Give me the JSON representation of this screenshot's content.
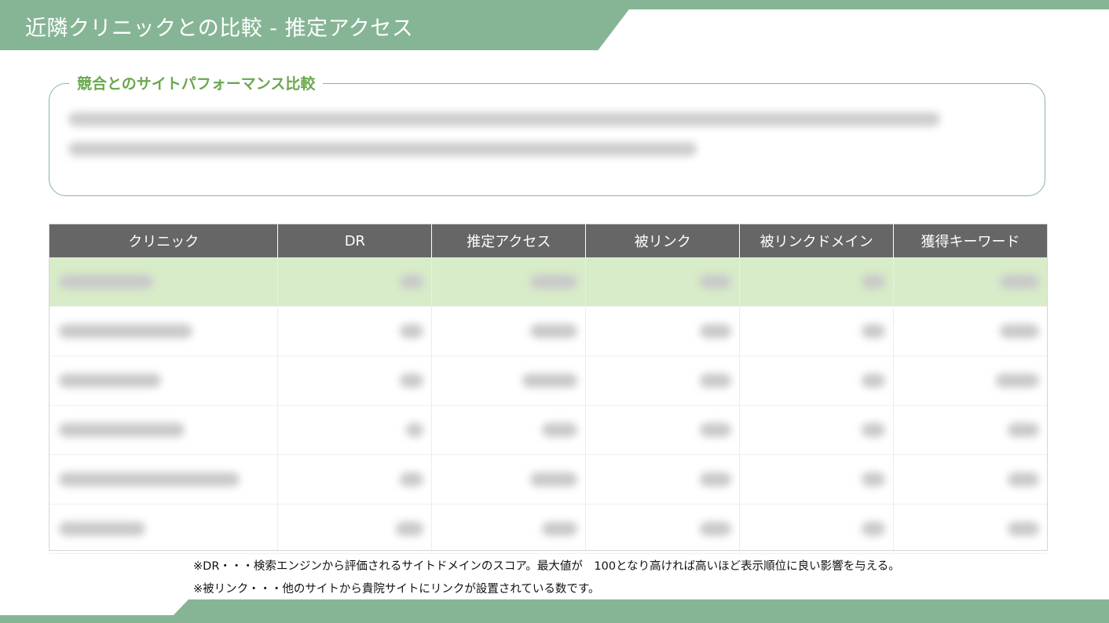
{
  "header": {
    "title": "近隣クリニックとの比較 - 推定アクセス",
    "accent_color": "#86b596"
  },
  "summary": {
    "heading": "競合とのサイトパフォーマンス比較",
    "heading_color": "#6aa850"
  },
  "table": {
    "columns": [
      "クリニック",
      "DR",
      "推定アクセス",
      "被リンク",
      "被リンクドメイン",
      "獲得キーワード"
    ],
    "header_color": "#666666",
    "highlight_color": "#d8ecc9"
  },
  "notes": [
    "※DR・・・検索エンジンから評価されるサイトドメインのスコア。最大値が　100となり高ければ高いほど表示順位に良い影響を与える。",
    "※被リンク・・・他のサイトから貴院サイトにリンクが設置されている数です。"
  ]
}
